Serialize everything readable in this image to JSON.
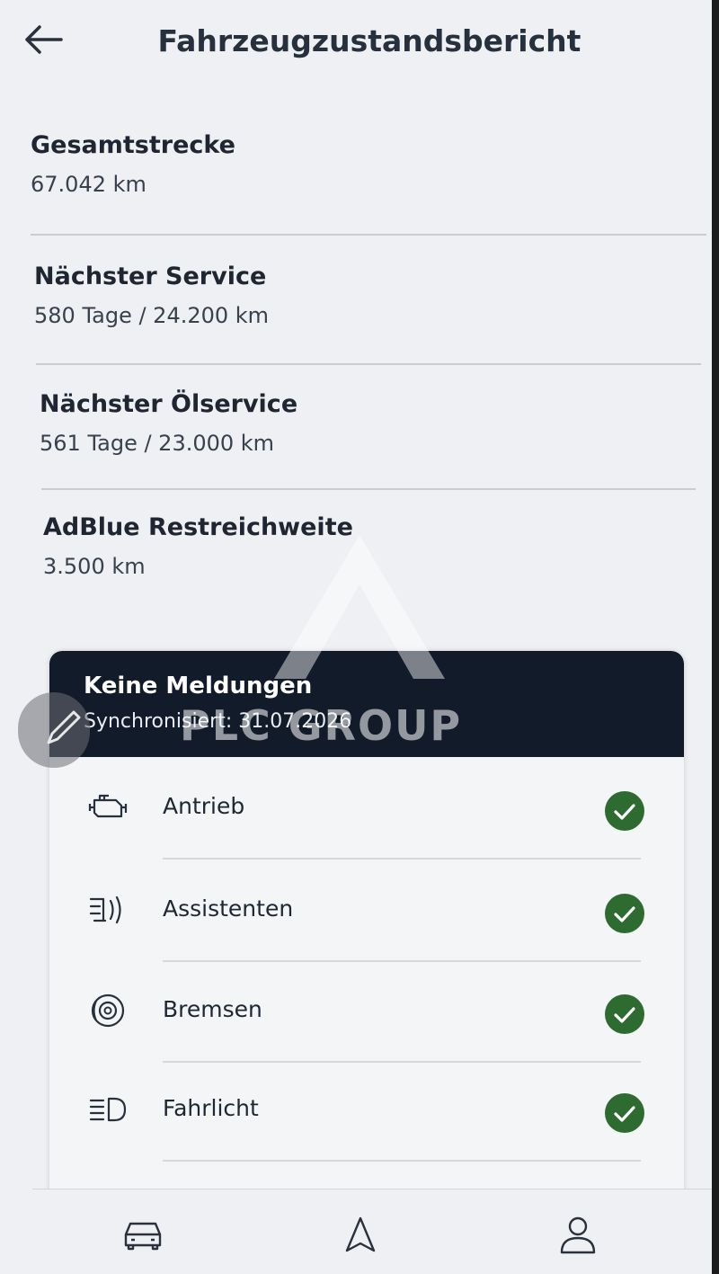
{
  "header": {
    "title": "Fahrzeugzustandsbericht"
  },
  "info": [
    {
      "label": "Gesamtstrecke",
      "value": "67.042 km"
    },
    {
      "label": "Nächster Service",
      "value": "580 Tage / 24.200 km"
    },
    {
      "label": "Nächster Ölservice",
      "value": "561 Tage / 23.000 km"
    },
    {
      "label": "AdBlue Restreichweite",
      "value": "3.500 km"
    }
  ],
  "status_card": {
    "title": "Keine Meldungen",
    "subtitle": "Synchronisiert: 31.07.2026",
    "items": [
      {
        "label": "Antrieb",
        "icon": "engine-icon",
        "status": "ok"
      },
      {
        "label": "Assistenten",
        "icon": "assistant-icon",
        "status": "ok"
      },
      {
        "label": "Bremsen",
        "icon": "brake-icon",
        "status": "ok"
      },
      {
        "label": "Fahrlicht",
        "icon": "headlight-icon",
        "status": "ok"
      }
    ]
  },
  "watermark": {
    "text": "PLC GROUP"
  },
  "bottom_nav": [
    {
      "icon": "car-icon"
    },
    {
      "icon": "navigation-icon"
    },
    {
      "icon": "profile-icon"
    }
  ],
  "colors": {
    "card_header": "#121b2a",
    "ok_badge": "#2e6b30",
    "background": "#eef0f3"
  }
}
